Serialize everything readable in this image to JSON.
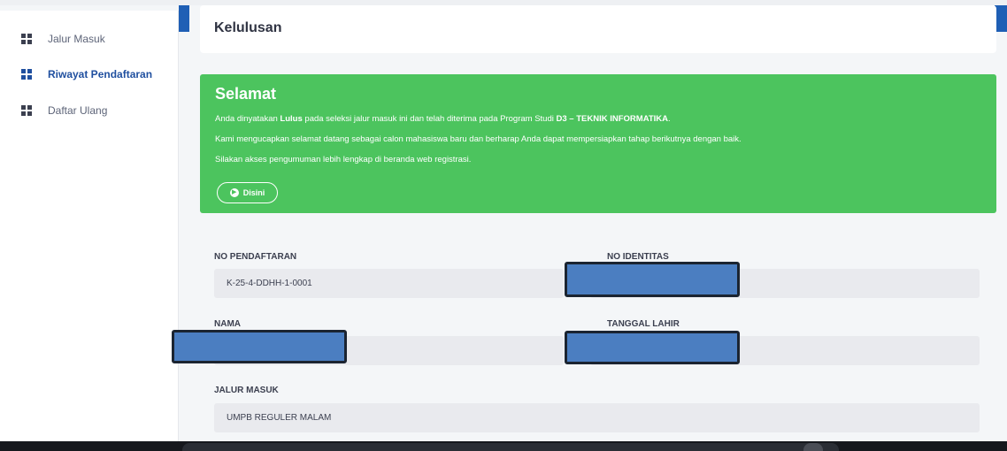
{
  "sidebar": {
    "items": [
      {
        "label": "Jalur Masuk",
        "icon": "grid-icon",
        "active": false
      },
      {
        "label": "Riwayat Pendaftaran",
        "icon": "grid-icon",
        "active": true
      },
      {
        "label": "Daftar Ulang",
        "icon": "grid-icon",
        "active": false
      }
    ]
  },
  "header": {
    "title": "Kelulusan"
  },
  "alert": {
    "title": "Selamat",
    "line1_a": "Anda dinyatakan ",
    "line1_b": "Lulus",
    "line1_c": " pada seleksi jalur masuk ini dan telah diterima pada Program Studi ",
    "line1_d": "D3 – TEKNIK INFORMATIKA",
    "line1_e": ".",
    "line2": "Kami mengucapkan selamat datang sebagai calon mahasiswa baru dan berharap Anda dapat mempersiapkan tahap berikutnya dengan baik.",
    "line3": "Silakan akses pengumuman lebih lengkap di beranda web registrasi.",
    "button_label": "Disini",
    "color": "#4cc45e"
  },
  "fields": {
    "no_pendaftaran": {
      "label": "NO PENDAFTARAN",
      "value": "K-25-4-DDHH-1-0001"
    },
    "no_identitas": {
      "label": "NO IDENTITAS",
      "value": ""
    },
    "nama": {
      "label": "NAMA",
      "value": ""
    },
    "tanggal_lahir": {
      "label": "TANGGAL LAHIR",
      "value": ""
    },
    "jalur_masuk": {
      "label": "JALUR MASUK",
      "value": "UMPB REGULER MALAM"
    }
  },
  "colors": {
    "primary": "#1f5fb5",
    "redaction": "#4b7ec1"
  }
}
